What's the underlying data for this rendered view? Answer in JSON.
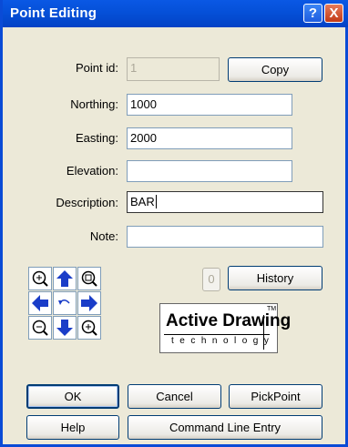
{
  "window": {
    "title": "Point Editing",
    "help_glyph": "?",
    "close_glyph": "X"
  },
  "fields": {
    "point_id": {
      "label": "Point id:",
      "value": "1"
    },
    "northing": {
      "label": "Northing:",
      "value": "1000"
    },
    "easting": {
      "label": "Easting:",
      "value": "2000"
    },
    "elevation": {
      "label": "Elevation:",
      "value": ""
    },
    "description": {
      "label": "Description:",
      "value": "BAR"
    },
    "note": {
      "label": "Note:",
      "value": ""
    }
  },
  "buttons": {
    "copy": "Copy",
    "history": "History",
    "zero": "0",
    "ok": "OK",
    "cancel": "Cancel",
    "pickpoint": "PickPoint",
    "help": "Help",
    "command_line": "Command Line Entry"
  },
  "logo": {
    "main": "Active Drawing",
    "sub": "technology",
    "tm": "TM"
  },
  "colors": {
    "titlebar": "#0550D8",
    "arrow": "#1A3DC8",
    "dialog_bg": "#ECE9D8"
  },
  "icons": [
    "zoom-in-icon",
    "arrow-up-icon",
    "zoom-window-icon",
    "arrow-left-icon",
    "undo-icon",
    "arrow-right-icon",
    "zoom-out-icon",
    "arrow-down-icon",
    "zoom-extents-icon"
  ]
}
